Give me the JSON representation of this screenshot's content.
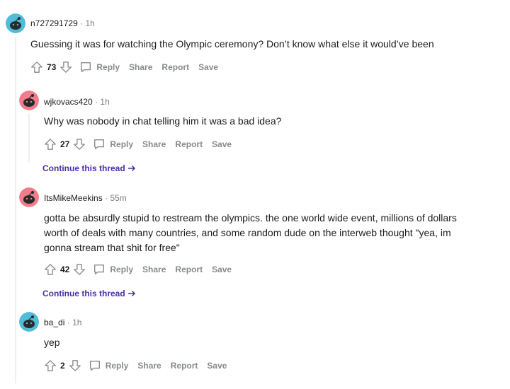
{
  "colors": {
    "avatar_teal": "#4fbcd9",
    "avatar_pink": "#f27c8c",
    "link_purple": "#4b2ea8",
    "muted": "#878a8c"
  },
  "comments": [
    {
      "username": "n727291729",
      "separator": "·",
      "time": "1h",
      "text": "Guessing it was for watching the Olympic ceremony? Don’t know what else it would’ve been",
      "score": "73",
      "avatar_color": "teal",
      "actions": {
        "reply": "Reply",
        "share": "Share",
        "report": "Report",
        "save": "Save"
      }
    },
    {
      "username": "wjkovacs420",
      "separator": "·",
      "time": "1h",
      "text": "Why was nobody in chat telling him it was a bad idea?",
      "score": "27",
      "avatar_color": "pink",
      "actions": {
        "reply": "Reply",
        "share": "Share",
        "report": "Report",
        "save": "Save"
      },
      "continue": "Continue this thread"
    },
    {
      "username": "ItsMikeMeekins",
      "separator": "·",
      "time": "55m",
      "text_lines": [
        "gotta be absurdly stupid to restream the olympics. the one world wide event, millions of dollars",
        "worth of deals with many countries, and some random dude on the interweb thought \"yea, im",
        "gonna stream that shit for free\""
      ],
      "score": "42",
      "avatar_color": "pink",
      "actions": {
        "reply": "Reply",
        "share": "Share",
        "report": "Report",
        "save": "Save"
      },
      "continue": "Continue this thread"
    },
    {
      "username": "ba_di",
      "separator": "·",
      "time": "1h",
      "text": "yep",
      "score": "2",
      "avatar_color": "teal",
      "actions": {
        "reply": "Reply",
        "share": "Share",
        "report": "Report",
        "save": "Save"
      }
    }
  ]
}
